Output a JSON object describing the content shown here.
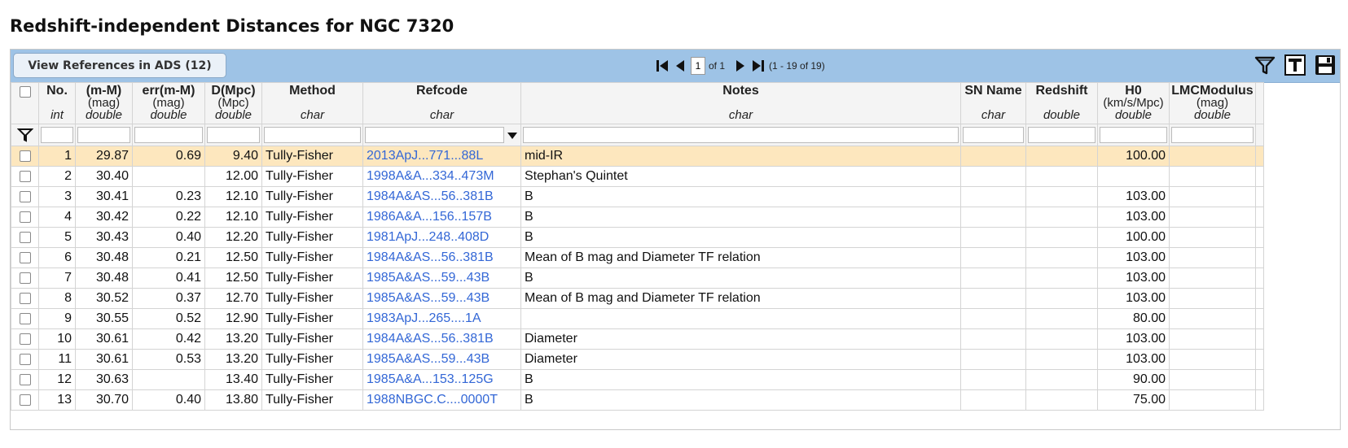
{
  "page": {
    "title": "Redshift-independent Distances for NGC 7320"
  },
  "toolbar": {
    "ads_button_label": "View References in ADS (12)",
    "pager": {
      "page_value": "1",
      "of_label": "of 1",
      "range_label": "(1 - 19 of 19)"
    },
    "icons": [
      "first-page-icon",
      "previous-page-icon",
      "next-page-icon",
      "last-page-icon",
      "filter-icon",
      "text-view-icon",
      "save-icon"
    ]
  },
  "columns": [
    {
      "name": "No.",
      "unit": "",
      "type": "int"
    },
    {
      "name": "(m-M)",
      "unit": "(mag)",
      "type": "double"
    },
    {
      "name": "err(m-M)",
      "unit": "(mag)",
      "type": "double"
    },
    {
      "name": "D(Mpc)",
      "unit": "(Mpc)",
      "type": "double"
    },
    {
      "name": "Method",
      "unit": "",
      "type": "char"
    },
    {
      "name": "Refcode",
      "unit": "",
      "type": "char"
    },
    {
      "name": "Notes",
      "unit": "",
      "type": "char"
    },
    {
      "name": "SN Name",
      "unit": "",
      "type": "char"
    },
    {
      "name": "Redshift",
      "unit": "",
      "type": "double"
    },
    {
      "name": "H0",
      "unit": "(km/s/Mpc)",
      "type": "double"
    },
    {
      "name": "LMCModulus",
      "unit": "(mag)",
      "type": "double"
    }
  ],
  "rows": [
    [
      "1",
      "29.87",
      "0.69",
      "9.40",
      "Tully-Fisher",
      "2013ApJ...771...88L",
      "mid-IR",
      "",
      "",
      "100.00",
      ""
    ],
    [
      "2",
      "30.40",
      "",
      "12.00",
      "Tully-Fisher",
      "1998A&A...334..473M",
      "Stephan's Quintet",
      "",
      "",
      "",
      ""
    ],
    [
      "3",
      "30.41",
      "0.23",
      "12.10",
      "Tully-Fisher",
      "1984A&AS...56..381B",
      "B",
      "",
      "",
      "103.00",
      ""
    ],
    [
      "4",
      "30.42",
      "0.22",
      "12.10",
      "Tully-Fisher",
      "1986A&A...156..157B",
      "B",
      "",
      "",
      "103.00",
      ""
    ],
    [
      "5",
      "30.43",
      "0.40",
      "12.20",
      "Tully-Fisher",
      "1981ApJ...248..408D",
      "B",
      "",
      "",
      "100.00",
      ""
    ],
    [
      "6",
      "30.48",
      "0.21",
      "12.50",
      "Tully-Fisher",
      "1984A&AS...56..381B",
      "Mean of B mag and Diameter TF relation",
      "",
      "",
      "103.00",
      ""
    ],
    [
      "7",
      "30.48",
      "0.41",
      "12.50",
      "Tully-Fisher",
      "1985A&AS...59...43B",
      "B",
      "",
      "",
      "103.00",
      ""
    ],
    [
      "8",
      "30.52",
      "0.37",
      "12.70",
      "Tully-Fisher",
      "1985A&AS...59...43B",
      "Mean of B mag and Diameter TF relation",
      "",
      "",
      "103.00",
      ""
    ],
    [
      "9",
      "30.55",
      "0.52",
      "12.90",
      "Tully-Fisher",
      "1983ApJ...265....1A",
      "",
      "",
      "",
      "80.00",
      ""
    ],
    [
      "10",
      "30.61",
      "0.42",
      "13.20",
      "Tully-Fisher",
      "1984A&AS...56..381B",
      "Diameter",
      "",
      "",
      "103.00",
      ""
    ],
    [
      "11",
      "30.61",
      "0.53",
      "13.20",
      "Tully-Fisher",
      "1985A&AS...59...43B",
      "Diameter",
      "",
      "",
      "103.00",
      ""
    ],
    [
      "12",
      "30.63",
      "",
      "13.40",
      "Tully-Fisher",
      "1985A&A...153..125G",
      "B",
      "",
      "",
      "90.00",
      ""
    ],
    [
      "13",
      "30.70",
      "0.40",
      "13.80",
      "Tully-Fisher",
      "1988NBGC.C....0000T",
      "B",
      "",
      "",
      "75.00",
      ""
    ]
  ],
  "highlighted_row": 0,
  "colors": {
    "toolbar_bg": "#9ec3e6",
    "highlight_row": "#fde7be",
    "link": "#3367d6"
  }
}
